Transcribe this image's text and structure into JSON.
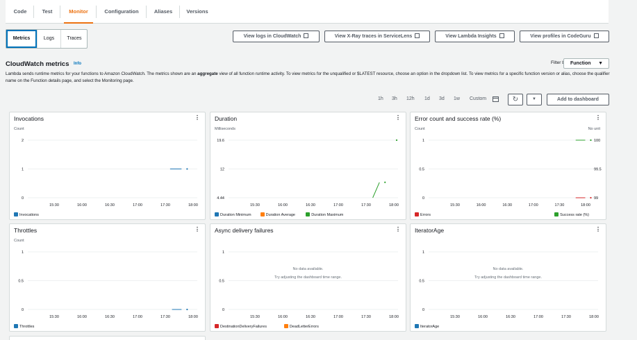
{
  "tabs": [
    "Code",
    "Test",
    "Monitor",
    "Configuration",
    "Aliases",
    "Versions"
  ],
  "active_tab": "Monitor",
  "subtabs": [
    "Metrics",
    "Logs",
    "Traces"
  ],
  "actions": {
    "cloudwatch_logs": "View logs in CloudWatch",
    "xray": "View X-Ray traces in ServiceLens",
    "insights": "View Lambda Insights",
    "codeguru": "View profiles in CodeGuru"
  },
  "section": {
    "title": "CloudWatch metrics",
    "info": "Info",
    "filter_label": "Filter by",
    "filter_value": "Function",
    "desc_1": "Lambda sends runtime metrics for your functions to Amazon CloudWatch. The metrics shown are an ",
    "desc_bold": "aggregate",
    "desc_2": " view of all function runtime activity. To view metrics for the unqualified or $LATEST resource, choose an option in the dropdown list. To view metrics for a specific function version or alias, choose the qualifier name on the Function details page, and select the Monitoring page."
  },
  "time_ranges": [
    "1h",
    "3h",
    "12h",
    "1d",
    "3d",
    "1w",
    "Custom"
  ],
  "add_dashboard": "Add to dashboard",
  "colors": {
    "blue": "#1f77b4",
    "orange": "#ff7f0e",
    "green": "#2ca02c",
    "red": "#d62728",
    "accent": "#ec7211",
    "link": "#0073bb"
  },
  "icons": [
    "refresh-icon",
    "caret-down-icon",
    "external-link-icon",
    "calendar-icon",
    "menu-dots-icon"
  ],
  "x_ticks": [
    "15:30",
    "16:00",
    "16:30",
    "17:00",
    "17:30",
    "18:00"
  ],
  "no_data": {
    "title": "No data available.",
    "hint": "Try adjusting the dashboard time range."
  },
  "widgets": [
    {
      "title": "Invocations",
      "unit": "Count",
      "y_ticks": [
        "2",
        "1",
        "0"
      ],
      "legend": [
        "Invocations"
      ]
    },
    {
      "title": "Duration",
      "unit": "Milliseconds",
      "y_ticks": [
        "19.6",
        "12",
        "4.44"
      ],
      "legend": [
        "Duration Minimum",
        "Duration Average",
        "Duration Maximum"
      ]
    },
    {
      "title": "Error count and success rate (%)",
      "unit": "Count",
      "unit_right": "No unit",
      "y_ticks": [
        "1",
        "0.5",
        "0"
      ],
      "y_ticks_right": [
        "100",
        "99.5",
        "99"
      ],
      "legend": [
        "Errors",
        "Success rate (%)"
      ]
    },
    {
      "title": "Throttles",
      "unit": "Count",
      "y_ticks": [
        "1",
        "0.5",
        "0"
      ],
      "legend": [
        "Throttles"
      ]
    },
    {
      "title": "Async delivery failures",
      "y_ticks": [
        "1",
        "0.5",
        "0"
      ],
      "legend": [
        "DestinationDeliveryFailures",
        "DeadLetterErrors"
      ]
    },
    {
      "title": "IteratorAge",
      "y_ticks": [
        "1",
        "0.5",
        "0"
      ],
      "legend": [
        "IteratorAge"
      ]
    }
  ],
  "chart_data": [
    {
      "type": "line",
      "title": "Invocations",
      "ylabel": "Count",
      "ylim": [
        0,
        2
      ],
      "series": [
        {
          "name": "Invocations",
          "x": [
            "17:33",
            "17:39",
            "17:45"
          ],
          "values": [
            1,
            1,
            1
          ]
        }
      ]
    },
    {
      "type": "line",
      "title": "Duration",
      "ylabel": "Milliseconds",
      "ylim": [
        4.44,
        19.6
      ],
      "series": [
        {
          "name": "Duration Maximum",
          "x": [
            "17:35",
            "17:42"
          ],
          "values": [
            4.44,
            8.5
          ]
        },
        {
          "name": "Duration Maximum",
          "x": [
            "18:00"
          ],
          "values": [
            19.6
          ]
        }
      ]
    },
    {
      "type": "line",
      "title": "Error count and success rate (%)",
      "ylim": [
        0,
        1
      ],
      "ylim_right": [
        99,
        100
      ],
      "series": [
        {
          "name": "Errors",
          "x": [
            "17:38",
            "17:48"
          ],
          "values": [
            0,
            0
          ]
        },
        {
          "name": "Success rate (%)",
          "x": [
            "17:38",
            "17:48"
          ],
          "values": [
            100,
            100
          ]
        }
      ]
    },
    {
      "type": "line",
      "title": "Throttles",
      "ylabel": "Count",
      "ylim": [
        0,
        1
      ],
      "series": [
        {
          "name": "Throttles",
          "x": [
            "17:35",
            "17:45"
          ],
          "values": [
            0,
            0
          ]
        }
      ]
    },
    {
      "type": "line",
      "title": "Async delivery failures",
      "ylim": [
        0,
        1
      ],
      "series": []
    },
    {
      "type": "line",
      "title": "IteratorAge",
      "ylim": [
        0,
        1
      ],
      "series": []
    }
  ]
}
